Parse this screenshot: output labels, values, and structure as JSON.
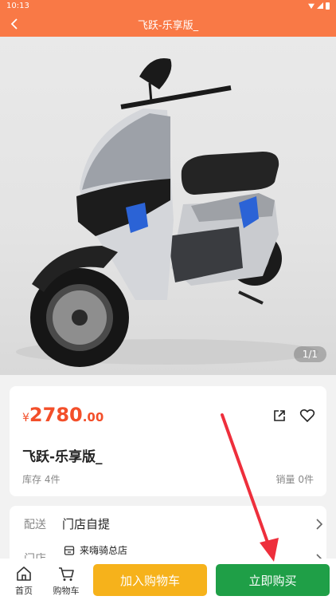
{
  "status_bar": {
    "time": "10:13"
  },
  "header": {
    "title": "飞跃-乐享版_",
    "back_icon": "chevron-left-icon"
  },
  "gallery": {
    "counter": "1/1"
  },
  "product": {
    "currency": "¥",
    "price_integer": "2780",
    "price_decimal": ".00",
    "name": "飞跃-乐享版_",
    "stock": "库存 4件",
    "sales": "销量 0件",
    "share_icon": "share-icon",
    "favorite_icon": "heart-icon"
  },
  "delivery": {
    "label": "配送",
    "value": "门店自提",
    "store_label": "门店",
    "store_name": "来嗨骑总店"
  },
  "bottom_bar": {
    "home_label": "首页",
    "cart_label": "购物车",
    "add_to_cart": "加入购物车",
    "buy_now": "立即购买"
  },
  "colors": {
    "header": "#f97946",
    "price": "#f34f2a",
    "add_to_cart_button": "#f6b21b",
    "buy_now_button": "#1f9f47",
    "annotation_arrow": "#ee2f3c"
  }
}
